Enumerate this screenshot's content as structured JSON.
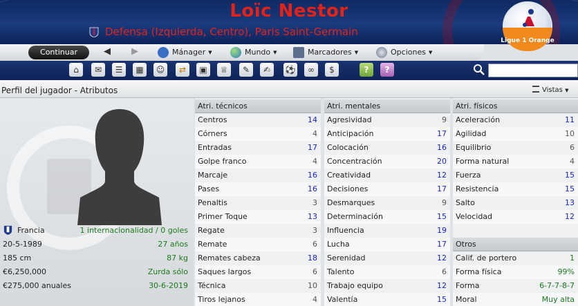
{
  "header": {
    "player_name": "Loïc Nestor",
    "player_role": "Defensa (Izquierda, Centro), Paris Saint-Germain",
    "league_logo_text": "Ligue 1 Orange"
  },
  "toolbar": {
    "continue_label": "Continuar",
    "back_arrow": "◀",
    "forward_arrow": "▶",
    "menus": [
      {
        "label": "Mánager",
        "icon": "manager-icon"
      },
      {
        "label": "Mundo",
        "icon": "globe-icon"
      },
      {
        "label": "Marcadores",
        "icon": "bookmark-icon"
      },
      {
        "label": "Opciones",
        "icon": "options-icon"
      }
    ],
    "search_placeholder": ""
  },
  "page": {
    "title": "Perfil del jugador - Atributos",
    "views_label": "Vistas"
  },
  "profile": {
    "nationality": "Francia",
    "caps": "1 internacionalidad / 0 goles",
    "dob": "20-5-1989",
    "age": "27 años",
    "height": "185 cm",
    "weight": "87 kg",
    "value": "€6,250,000",
    "foot": "Zurda sólo",
    "wage": "€275,000 anuales",
    "contract": "30-6-2019"
  },
  "technical": {
    "title": "Atri. técnicos",
    "rows": [
      {
        "name": "Centros",
        "value": "14"
      },
      {
        "name": "Córners",
        "value": "4"
      },
      {
        "name": "Entradas",
        "value": "17"
      },
      {
        "name": "Golpe franco",
        "value": "4"
      },
      {
        "name": "Marcaje",
        "value": "16"
      },
      {
        "name": "Pases",
        "value": "16"
      },
      {
        "name": "Penaltis",
        "value": "3"
      },
      {
        "name": "Primer Toque",
        "value": "13"
      },
      {
        "name": "Regate",
        "value": "3"
      },
      {
        "name": "Remate",
        "value": "6"
      },
      {
        "name": "Remates cabeza",
        "value": "18"
      },
      {
        "name": "Saques largos",
        "value": "6"
      },
      {
        "name": "Técnica",
        "value": "10"
      },
      {
        "name": "Tiros lejanos",
        "value": "4"
      }
    ]
  },
  "mental": {
    "title": "Atri. mentales",
    "rows": [
      {
        "name": "Agresividad",
        "value": "9"
      },
      {
        "name": "Anticipación",
        "value": "17"
      },
      {
        "name": "Colocación",
        "value": "16"
      },
      {
        "name": "Concentración",
        "value": "20"
      },
      {
        "name": "Creatividad",
        "value": "12"
      },
      {
        "name": "Decisiones",
        "value": "17"
      },
      {
        "name": "Desmarques",
        "value": "9"
      },
      {
        "name": "Determinación",
        "value": "15"
      },
      {
        "name": "Influencia",
        "value": "19"
      },
      {
        "name": "Lucha",
        "value": "17"
      },
      {
        "name": "Serenidad",
        "value": "12"
      },
      {
        "name": "Talento",
        "value": "6"
      },
      {
        "name": "Trabajo equipo",
        "value": "12"
      },
      {
        "name": "Valentía",
        "value": "15"
      }
    ]
  },
  "physical": {
    "title": "Atri. físicos",
    "rows": [
      {
        "name": "Aceleración",
        "value": "11"
      },
      {
        "name": "Agilidad",
        "value": "10"
      },
      {
        "name": "Equilibrio",
        "value": "6"
      },
      {
        "name": "Forma natural",
        "value": "4"
      },
      {
        "name": "Fuerza",
        "value": "15"
      },
      {
        "name": "Resistencia",
        "value": "15"
      },
      {
        "name": "Salto",
        "value": "13"
      },
      {
        "name": "Velocidad",
        "value": "12"
      }
    ]
  },
  "other": {
    "title": "Otros",
    "rows": [
      {
        "name": "Calif. de portero",
        "value": "1"
      },
      {
        "name": "Forma física",
        "value": "99%"
      },
      {
        "name": "Forma",
        "value": "6-7-7-8-7"
      },
      {
        "name": "Moral",
        "value": "Muy alta"
      }
    ]
  },
  "colors": {
    "high_attribute": "#1a23c9",
    "low_attribute": "#555555",
    "positive_info": "#1b7a1b",
    "name_red": "#e2231a",
    "header_blue": "#1a3b7e"
  }
}
